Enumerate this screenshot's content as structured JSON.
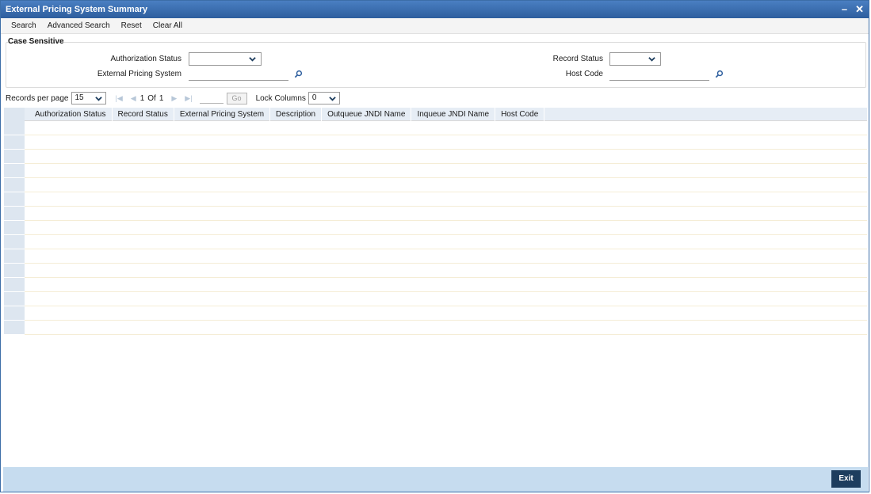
{
  "window": {
    "title": "External Pricing System Summary",
    "minimize": "–",
    "close": "✕"
  },
  "toolbar": {
    "search": "Search",
    "advanced_search": "Advanced Search",
    "reset": "Reset",
    "clear_all": "Clear All"
  },
  "criteria": {
    "section_label": "Case Sensitive",
    "authorization_status_label": "Authorization Status",
    "authorization_status_value": "",
    "external_pricing_system_label": "External Pricing System",
    "external_pricing_system_value": "",
    "record_status_label": "Record Status",
    "record_status_value": "",
    "host_code_label": "Host Code",
    "host_code_value": ""
  },
  "pager": {
    "records_per_page_label": "Records per page",
    "records_per_page_value": "15",
    "current_page": "1",
    "of_label": "Of",
    "total_pages": "1",
    "go_label": "Go",
    "lock_columns_label": "Lock Columns",
    "lock_columns_value": "0"
  },
  "grid": {
    "columns": [
      "Authorization Status",
      "Record Status",
      "External Pricing System",
      "Description",
      "Outqueue JNDI Name",
      "Inqueue JNDI Name",
      "Host Code"
    ],
    "empty_row_count": 15
  },
  "footer": {
    "exit_label": "Exit"
  },
  "icons": {
    "chevron": "chevron-down-icon",
    "lookup": "search-icon",
    "first": "first-page-icon",
    "prev": "previous-page-icon",
    "next": "next-page-icon",
    "last": "last-page-icon"
  },
  "colors": {
    "titlebar": "#2d5e9e",
    "footer": "#c6dcef",
    "exit_button": "#1d3d5e",
    "header_row": "#e6edf5"
  }
}
